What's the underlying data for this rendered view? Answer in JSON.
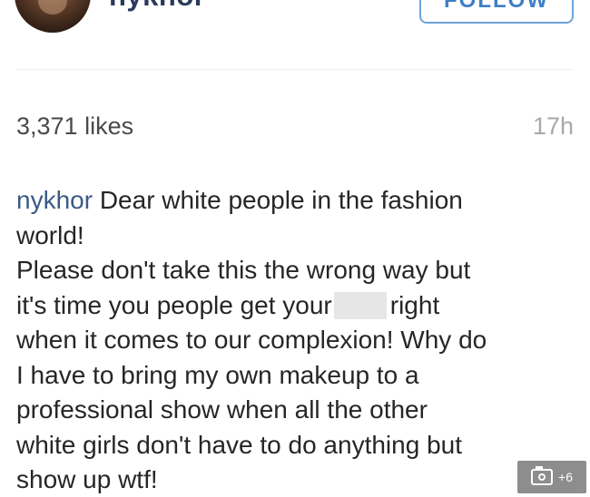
{
  "header": {
    "username": "nykhor",
    "follow_label": "FOLLOW"
  },
  "stats": {
    "likes": "3,371 likes",
    "time": "17h"
  },
  "caption": {
    "author": "nykhor",
    "lines": [
      " Dear white people in the fashion",
      "world!",
      "Please don't take this the wrong way but",
      "it's time you people get your",
      "right",
      "when it comes to our complexion! Why do",
      "I have to bring my own makeup to a",
      "professional show when all the other",
      "white girls don't have to do anything but",
      "show up wtf!"
    ]
  },
  "media_badge": {
    "icon": "camera-icon",
    "count": "+6"
  }
}
